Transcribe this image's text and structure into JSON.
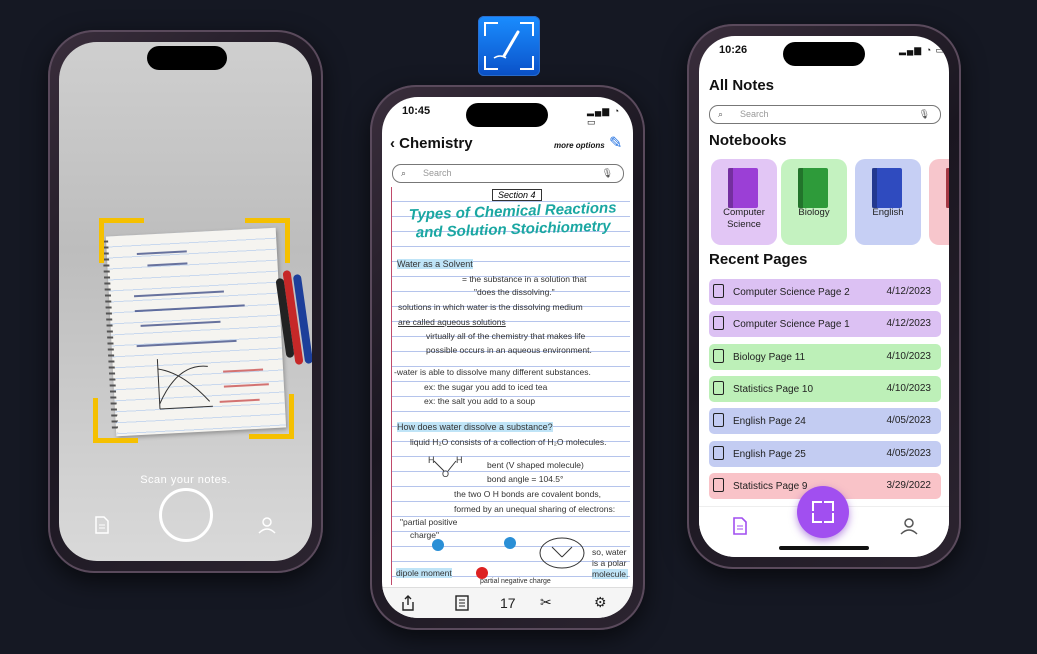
{
  "camera_screen": {
    "hint": "Scan your notes."
  },
  "note_screen": {
    "time": "10:45",
    "title": "Chemistry",
    "more_options": "more options",
    "search_placeholder": "Search",
    "section_tag": "Section 4",
    "big_title_line1": "Types of Chemical Reactions",
    "big_title_line2": "and Solution Stoichiometry",
    "lines": [
      "Water as a Solvent",
      "= the substance in a solution that",
      "\"does the dissolving.\"",
      "solutions in which water is the dissolving medium",
      "are called aqueous solutions",
      "virtually all of the chemistry that makes life",
      "possible occurs in an aqueous environment.",
      "-water is able to dissolve many different substances.",
      "ex: the sugar you add to iced tea",
      "ex: the salt you add to a soup",
      "How does water dissolve a substance?",
      "liquid H₂O consists of a collection of H₂O molecules.",
      "bent (V shaped molecule)",
      "bond angle = 104.5°",
      "the two O H bonds are covalent bonds,",
      "formed by an unequal sharing of electrons:",
      "\"partial positive",
      "charge\"",
      "dipole moment",
      "partial negative charge",
      "so, water",
      "is a polar",
      "molecule."
    ],
    "page_number": "17"
  },
  "library_screen": {
    "time": "10:26",
    "title": "All Notes",
    "search_placeholder": "Search",
    "notebooks_heading": "Notebooks",
    "notebooks": [
      {
        "name_line1": "Computer",
        "name_line2": "Science",
        "bg": "#e2c6f5",
        "book": "#9b3fd6"
      },
      {
        "name_line1": "Biology",
        "name_line2": "",
        "bg": "#c4f2c0",
        "book": "#2e9b3a"
      },
      {
        "name_line1": "English",
        "name_line2": "",
        "bg": "#c6cff4",
        "book": "#2f4bbf"
      },
      {
        "name_line1": "S",
        "name_line2": "",
        "bg": "#f7c6cc",
        "book": "#d94a5a"
      }
    ],
    "recent_heading": "Recent Pages",
    "recent_pages": [
      {
        "name": "Computer Science Page 2",
        "date": "4/12/2023",
        "color": "#dcc1f3"
      },
      {
        "name": "Computer Science Page 1",
        "date": "4/12/2023",
        "color": "#dcc1f3"
      },
      {
        "name": "Biology Page 11",
        "date": "4/10/2023",
        "color": "#bdf0b8"
      },
      {
        "name": "Statistics Page 10",
        "date": "4/10/2023",
        "color": "#bdf0b8"
      },
      {
        "name": "English Page 24",
        "date": "4/05/2023",
        "color": "#c3ccf2"
      },
      {
        "name": "English Page 25",
        "date": "4/05/2023",
        "color": "#c3ccf2"
      },
      {
        "name": "Statistics Page 9",
        "date": "3/29/2022",
        "color": "#f9c3c8"
      }
    ]
  },
  "colors": {
    "background": "#151823",
    "accent_purple": "#a14ff0",
    "scan_corner": "#f5c000",
    "teal_title": "#1aa7a2",
    "app_icon_blue": "#1a8dff"
  },
  "icons": [
    "document-icon",
    "shutter-icon",
    "profile-icon",
    "back-chevron-icon",
    "pencil-icon",
    "search-icon",
    "mic-icon",
    "share-icon",
    "notebook-icon",
    "tools-icon",
    "settings-icon",
    "scan-icon"
  ]
}
